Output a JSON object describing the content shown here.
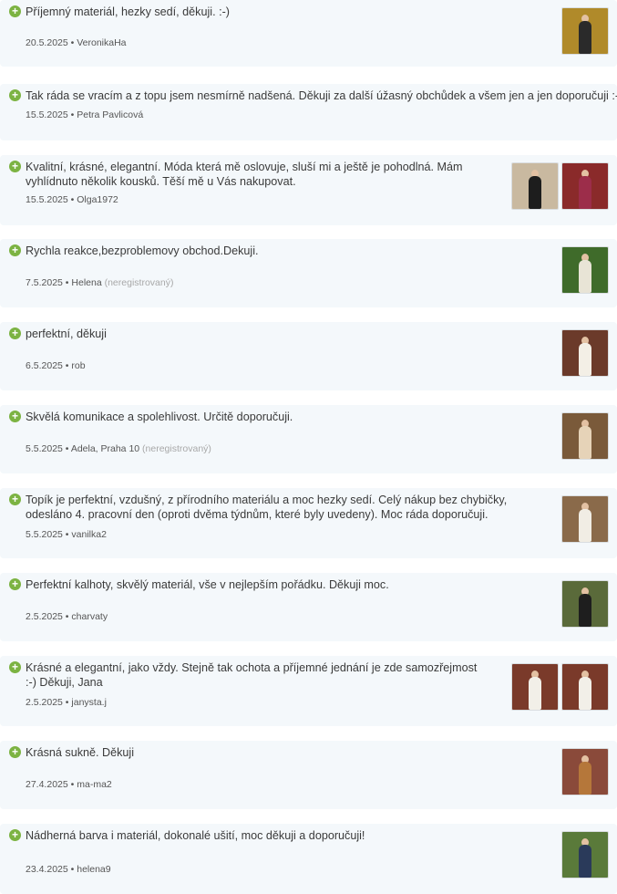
{
  "reviews": [
    {
      "text": "Příjemný materiál, hezky sedí, děkuji. :-)",
      "date": "20.5.2025",
      "author": "VeronikaHa",
      "unregistered": "",
      "photos": [
        {
          "bg": "#b08a2a",
          "fg": "#2a2a2a"
        }
      ]
    },
    {
      "text": "Tak ráda se vracím a z topu jsem nesmírně nadšená. Děkuji za další úžasný obchůdek a všem jen a jen doporučuji :-),",
      "date": "15.5.2025",
      "author": "Petra Pavlicová",
      "unregistered": "",
      "photos": []
    },
    {
      "text": "Kvalitní, krásné, elegantní. Móda která mě oslovuje, sluší mi a ještě je pohodlná. Mám vyhlídnuto několik kousků. Těší mě u Vás nakupovat.",
      "date": "15.5.2025",
      "author": "Olga1972",
      "unregistered": "",
      "photos": [
        {
          "bg": "#c9b9a0",
          "fg": "#1d1d1d"
        },
        {
          "bg": "#8a2a2a",
          "fg": "#9c2d4a"
        }
      ]
    },
    {
      "text": "Rychla reakce,bezproblemovy obchod.Dekuji.",
      "date": "7.5.2025",
      "author": "Helena",
      "unregistered": "(neregistrovaný)",
      "photos": [
        {
          "bg": "#3f6b2a",
          "fg": "#e8e4d6"
        }
      ]
    },
    {
      "text": "perfektní, děkuji",
      "date": "6.5.2025",
      "author": "rob",
      "unregistered": "",
      "photos": [
        {
          "bg": "#6b3a2a",
          "fg": "#f3efe6"
        }
      ]
    },
    {
      "text": "Skvělá komunikace a spolehlivost. Určitě doporučuji.",
      "date": "5.5.2025",
      "author": "Adela, Praha 10",
      "unregistered": "(neregistrovaný)",
      "photos": [
        {
          "bg": "#7a5a3a",
          "fg": "#e6d3b8"
        }
      ]
    },
    {
      "text": "Topík je perfektní, vzdušný, z přírodního materiálu a moc hezky sedí. Celý nákup bez chybičky, odesláno 4. pracovní den (oproti dvěma týdnům, které byly uvedeny). Moc ráda doporučuji.",
      "date": "5.5.2025",
      "author": "vanilka2",
      "unregistered": "",
      "photos": [
        {
          "bg": "#8a6a4a",
          "fg": "#f1ede4"
        }
      ]
    },
    {
      "text": "Perfektní kalhoty, skvělý materiál, vše v nejlepším pořádku. Děkuji moc.",
      "date": "2.5.2025",
      "author": "charvaty",
      "unregistered": "",
      "photos": [
        {
          "bg": "#5a6a3a",
          "fg": "#1e1e1e"
        }
      ]
    },
    {
      "text": "Krásné a elegantní, jako vždy. Stejně tak ochota a příjemné jednání je zde samozřejmost :-) Děkuji, Jana",
      "date": "2.5.2025",
      "author": "janysta.j",
      "unregistered": "",
      "photos": [
        {
          "bg": "#7a3a2a",
          "fg": "#f2efe8"
        },
        {
          "bg": "#7a3a2a",
          "fg": "#f2efe8"
        }
      ]
    },
    {
      "text": "Krásná sukně. Děkuji",
      "date": "27.4.2025",
      "author": "ma-ma2",
      "unregistered": "",
      "photos": [
        {
          "bg": "#8a4a3a",
          "fg": "#b5773a"
        }
      ]
    },
    {
      "text": "Nádherná barva i materiál, dokonalé ušití, moc děkuji a doporučuji!",
      "date": "23.4.2025",
      "author": "helena9",
      "unregistered": "",
      "photos": [
        {
          "bg": "#5a7a3a",
          "fg": "#2a3a5a"
        }
      ]
    }
  ]
}
